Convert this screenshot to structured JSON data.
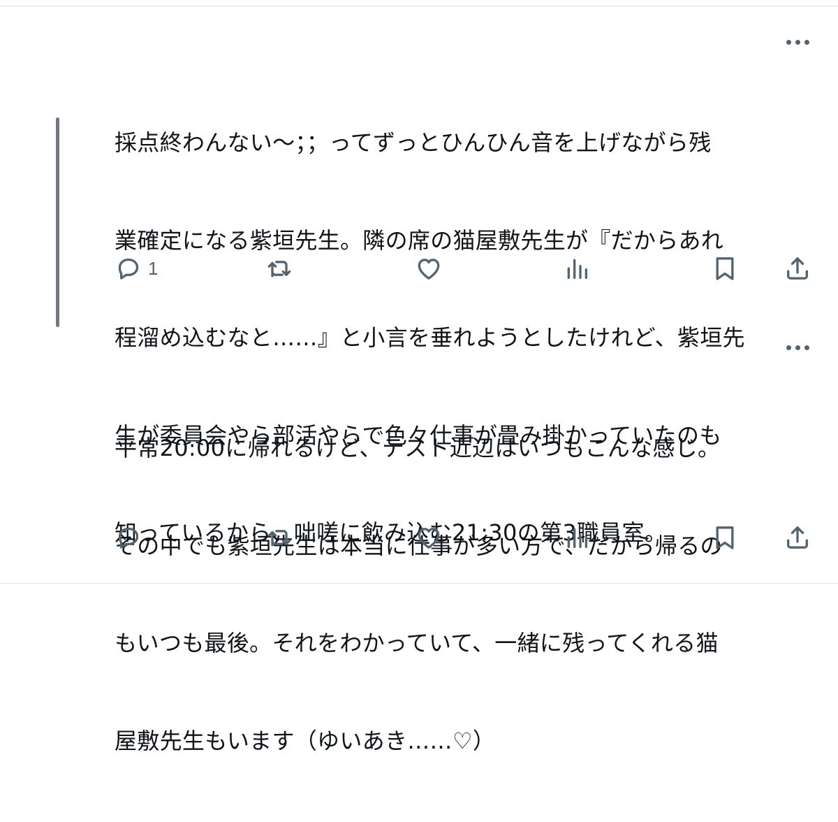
{
  "tweets": [
    {
      "text_lines": [
        "採点終わんない〜；；ってずっとひんひん音を上げながら残",
        "業確定になる紫垣先生。隣の席の猫屋敷先生が『だからあれ",
        "程溜め込むなと……』と小言を垂れようとしたけれど、紫垣先",
        "生が委員会やら部活やらで色々仕事が畳み掛かっていたのも",
        "知っているから、咄嗟に飲み込む21:30の第3職員室。"
      ],
      "reply_count": "1"
    },
    {
      "text_lines": [
        "平常20:00に帰れるけど、テスト近辺はいつもこんな感じ。",
        "その中でも紫垣先生は本当に仕事が多い方で、だから帰るの",
        "もいつも最後。それをわかっていて、一緒に残ってくれる猫",
        "屋敷先生もいます（ゆいあき……♡）"
      ],
      "reply_count": ""
    }
  ],
  "icons": {
    "more": "more-horizontal-icon",
    "reply": "reply-bubble-icon",
    "retweet": "retweet-icon",
    "like": "heart-icon",
    "views": "views-bar-chart-icon",
    "bookmark": "bookmark-icon",
    "share": "share-upload-icon"
  },
  "colors": {
    "text": "#0f1419",
    "secondary": "#536471",
    "divider": "#e1e5ea",
    "thread_line": "#6f7a85"
  }
}
